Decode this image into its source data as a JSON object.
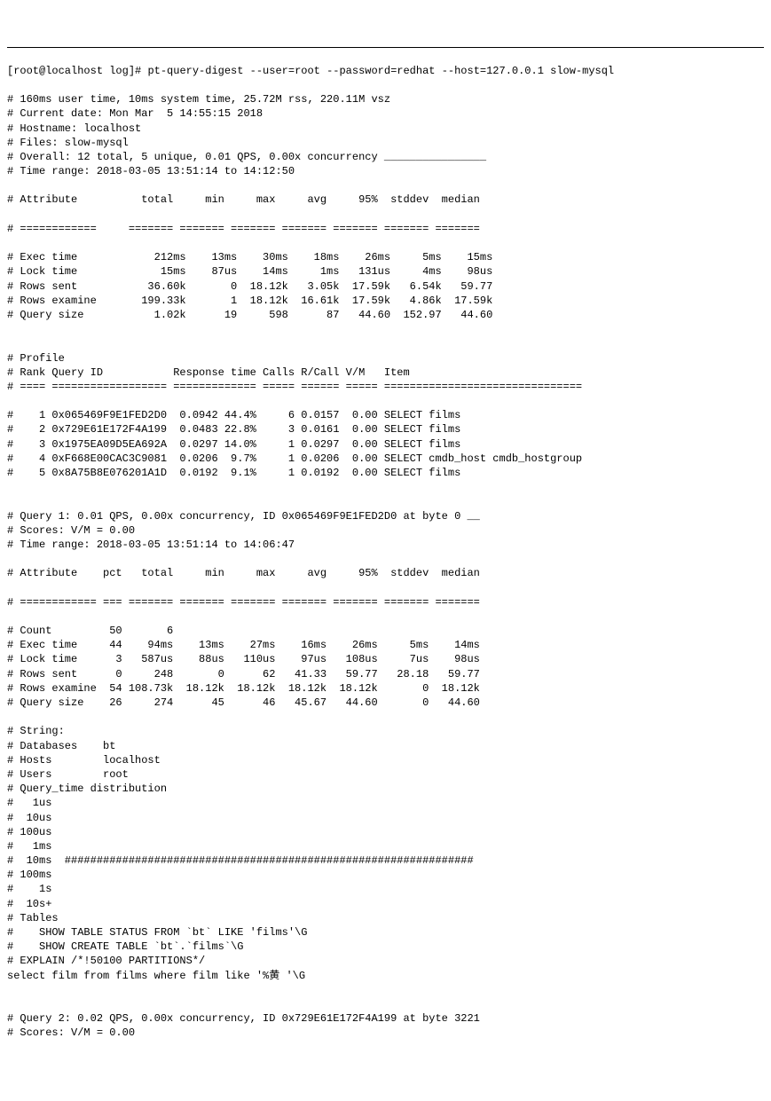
{
  "prompt": "[root@localhost log]# ",
  "command": "pt-query-digest --user=root --password=redhat --host=127.0.0.1 slow-mysql",
  "header": [
    "# 160ms user time, 10ms system time, 25.72M rss, 220.11M vsz",
    "# Current date: Mon Mar  5 14:55:15 2018",
    "# Hostname: localhost",
    "# Files: slow-mysql",
    "# Overall: 12 total, 5 unique, 0.01 QPS, 0.00x concurrency ________________",
    "# Time range: 2018-03-05 13:51:14 to 14:12:50"
  ],
  "overall_table_header": "# Attribute          total     min     max     avg     95%  stddev  median",
  "overall_table_divider": "# ============     ======= ======= ======= ======= ======= ======= =======",
  "overall_rows": [
    "# Exec time            212ms    13ms    30ms    18ms    26ms     5ms    15ms",
    "# Lock time             15ms    87us    14ms     1ms   131us     4ms    98us",
    "# Rows sent           36.60k       0  18.12k   3.05k  17.59k   6.54k   59.77",
    "# Rows examine       199.33k       1  18.12k  16.61k  17.59k   4.86k  17.59k",
    "# Query size           1.02k      19     598      87   44.60  152.97   44.60"
  ],
  "profile_header": [
    "# Profile",
    "# Rank Query ID           Response time Calls R/Call V/M   Item",
    "# ==== ================== ============= ===== ====== ===== ==============================="
  ],
  "profile_rows": [
    "#    1 0x065469F9E1FED2D0  0.0942 44.4%     6 0.0157  0.00 SELECT films",
    "#    2 0x729E61E172F4A199  0.0483 22.8%     3 0.0161  0.00 SELECT films",
    "#    3 0x1975EA09D5EA692A  0.0297 14.0%     1 0.0297  0.00 SELECT films",
    "#    4 0xF668E00CAC3C9081  0.0206  9.7%     1 0.0206  0.00 SELECT cmdb_host cmdb_hostgroup",
    "#    5 0x8A75B8E076201A1D  0.0192  9.1%     1 0.0192  0.00 SELECT films"
  ],
  "query1_header": [
    "# Query 1: 0.01 QPS, 0.00x concurrency, ID 0x065469F9E1FED2D0 at byte 0 __",
    "# Scores: V/M = 0.00",
    "# Time range: 2018-03-05 13:51:14 to 14:06:47"
  ],
  "query1_table_header": "# Attribute    pct   total     min     max     avg     95%  stddev  median",
  "query1_table_divider": "# ============ === ======= ======= ======= ======= ======= ======= =======",
  "query1_rows": [
    "# Count         50       6",
    "# Exec time     44    94ms    13ms    27ms    16ms    26ms     5ms    14ms",
    "# Lock time      3   587us    88us   110us    97us   108us     7us    98us",
    "# Rows sent      0     248       0      62   41.33   59.77   28.18   59.77",
    "# Rows examine  54 108.73k  18.12k  18.12k  18.12k  18.12k       0  18.12k",
    "# Query size    26     274      45      46   45.67   44.60       0   44.60"
  ],
  "query1_meta": [
    "# String:",
    "# Databases    bt",
    "# Hosts        localhost",
    "# Users        root",
    "# Query_time distribution",
    "#   1us",
    "#  10us",
    "# 100us",
    "#   1ms",
    "#  10ms  ################################################################",
    "# 100ms",
    "#    1s",
    "#  10s+",
    "# Tables",
    "#    SHOW TABLE STATUS FROM `bt` LIKE 'films'\\G",
    "#    SHOW CREATE TABLE `bt`.`films`\\G",
    "# EXPLAIN /*!50100 PARTITIONS*/",
    "select film from films where film like '%黄 '\\G"
  ],
  "query2_header": [
    "# Query 2: 0.02 QPS, 0.00x concurrency, ID 0x729E61E172F4A199 at byte 3221",
    "# Scores: V/M = 0.00"
  ]
}
